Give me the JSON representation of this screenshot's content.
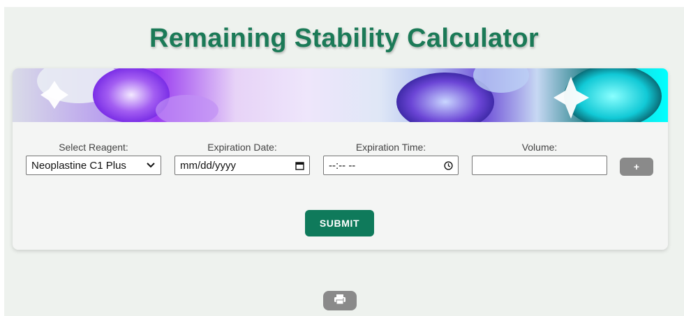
{
  "title": "Remaining Stability Calculator",
  "form": {
    "reagent": {
      "label": "Select Reagent:",
      "selected": "Neoplastine C1 Plus",
      "icon": "chevron-down-icon"
    },
    "expiration_date": {
      "label": "Expiration Date:",
      "placeholder": "mm/dd/yyyy",
      "icon": "calendar-icon"
    },
    "expiration_time": {
      "label": "Expiration Time:",
      "placeholder": "--:-- --",
      "icon": "clock-icon"
    },
    "volume": {
      "label": "Volume:",
      "value": ""
    },
    "add_label": "+",
    "submit_label": "SUBMIT"
  },
  "print": {
    "icon": "printer-icon"
  },
  "colors": {
    "title": "#1b7a57",
    "submit": "#0f7a5b",
    "secondary_button": "#8a8a8a",
    "page_background": "#eef2ee"
  }
}
